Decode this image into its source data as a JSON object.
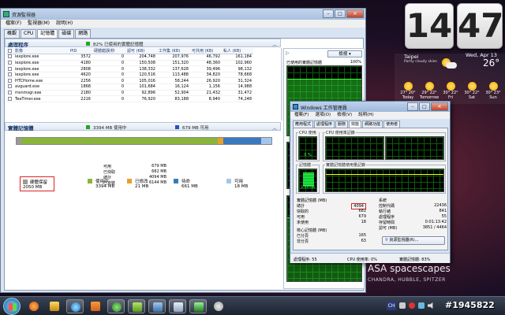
{
  "resmon": {
    "title": "資源監視器",
    "menu": [
      "檔案(F)",
      "監視器(M)",
      "說明(H)"
    ],
    "tabs": [
      "概觀",
      "CPU",
      "記憶體",
      "磁碟",
      "網路"
    ],
    "active_tab": "記憶體",
    "processes": {
      "title": "處理程序",
      "status": "82% 已使用的實體記憶體",
      "columns": [
        "影像",
        "PID",
        "硬體錯誤/秒",
        "認可 (KB)",
        "工作集 (KB)",
        "可共用 (KB)",
        "私人 (KB)"
      ],
      "rows": [
        [
          "iexplore.exe",
          "3572",
          "0",
          "204,748",
          "207,976",
          "46,792",
          "161,184"
        ],
        [
          "iexplore.exe",
          "4180",
          "0",
          "150,508",
          "151,320",
          "48,360",
          "102,960"
        ],
        [
          "iexplore.exe",
          "2808",
          "0",
          "138,332",
          "137,628",
          "39,496",
          "98,132"
        ],
        [
          "iexplore.exe",
          "4620",
          "0",
          "120,516",
          "113,488",
          "34,820",
          "78,668"
        ],
        [
          "HTCHome.exe",
          "2256",
          "0",
          "105,016",
          "58,244",
          "26,920",
          "31,324"
        ],
        [
          "avguard.exe",
          "1868",
          "0",
          "101,684",
          "16,124",
          "1,156",
          "14,988"
        ],
        [
          "msnmsgr.exe",
          "2180",
          "0",
          "92,896",
          "52,904",
          "21,432",
          "31,472"
        ],
        [
          "TeaTimer.exe",
          "2216",
          "0",
          "76,920",
          "83,188",
          "8,940",
          "74,248"
        ]
      ]
    },
    "memory": {
      "title": "實體記憶體",
      "in_use_text": "3394 MB 使用中",
      "available_text": "679 MB 可用",
      "legend": [
        {
          "name": "硬體保留",
          "value": "2050 MB",
          "color": "#9a9a9a"
        },
        {
          "name": "使用中",
          "value": "3394 MB",
          "color": "#8bb53a"
        },
        {
          "name": "已修改",
          "value": "21 MB",
          "color": "#e8a029"
        },
        {
          "name": "待命",
          "value": "661 MB",
          "color": "#3a79c0"
        },
        {
          "name": "可用",
          "value": "18 MB",
          "color": "#a5c6ea"
        }
      ],
      "stats": [
        {
          "k": "可用",
          "v": "679 MB"
        },
        {
          "k": "已快取",
          "v": "682 MB"
        },
        {
          "k": "總計",
          "v": "4094 MB"
        },
        {
          "k": "已安裝",
          "v": "6144 MB"
        }
      ],
      "bar_fractions": [
        0.02,
        0.77,
        0.02,
        0.15,
        0.04
      ]
    },
    "right_panel": {
      "view_label": "檢視",
      "graph_title": "已使用的實體記憶體",
      "graph_max": "100%"
    }
  },
  "taskmgr": {
    "title": "Windows 工作管理員",
    "menu": [
      "檔案(F)",
      "選項(O)",
      "檢視(V)",
      "說明(H)"
    ],
    "tabs": [
      "應用程式",
      "處理程序",
      "服務",
      "效能",
      "網路功能",
      "使用者"
    ],
    "active_tab": "效能",
    "cpu_usage_label": "CPU 使用率",
    "cpu_usage_value": "0 %",
    "cpu_history_label": "CPU 使用率記錄",
    "mem_label": "記憶體",
    "mem_value": "3.33 GB",
    "mem_history_label": "實體記憶體使用量記錄",
    "phys_mem": {
      "title": "實體記憶體 (MB)",
      "rows": [
        [
          "總計",
          "4094"
        ],
        [
          "快取的",
          "682"
        ],
        [
          "可用",
          "679"
        ],
        [
          "未使用",
          "18"
        ]
      ]
    },
    "kernel_mem": {
      "title": "核心記憶體 (MB)",
      "rows": [
        [
          "已分頁",
          "165"
        ],
        [
          "非分頁",
          "63"
        ]
      ]
    },
    "system": {
      "title": "系統",
      "rows": [
        [
          "控制代碼",
          "22436"
        ],
        [
          "執行緒",
          "841"
        ],
        [
          "處理程序",
          "55"
        ],
        [
          "存留時間",
          "0:01:13:42"
        ],
        [
          "認可 (MB)",
          "3851 / 4464"
        ]
      ]
    },
    "resmon_button": "資源監視器(R)...",
    "status_processes": "處理程序: 55",
    "status_cpu": "CPU 使用率: 0%",
    "status_mem": "實體記憶體: 83%"
  },
  "clock": {
    "hour": "14",
    "minute": "47"
  },
  "weather": {
    "city": "Taipei",
    "condition": "Partly cloudy skies",
    "date": "Wed, Apr 13",
    "temp": "26°",
    "forecast": [
      {
        "temp": "27° 20°",
        "day": "Today"
      },
      {
        "temp": "29° 22°",
        "day": "Tomorrow"
      },
      {
        "temp": "30° 22°",
        "day": "Fri"
      },
      {
        "temp": "30° 22°",
        "day": "Sat"
      },
      {
        "temp": "30° 23°",
        "day": "Sun"
      }
    ]
  },
  "wallpaper": {
    "brand": "ASA spacescapes",
    "credits": "CHANDRA, HUBBLE, SPITZER"
  },
  "watermark": "#1945822",
  "taskbar": {
    "lang": "CH"
  }
}
